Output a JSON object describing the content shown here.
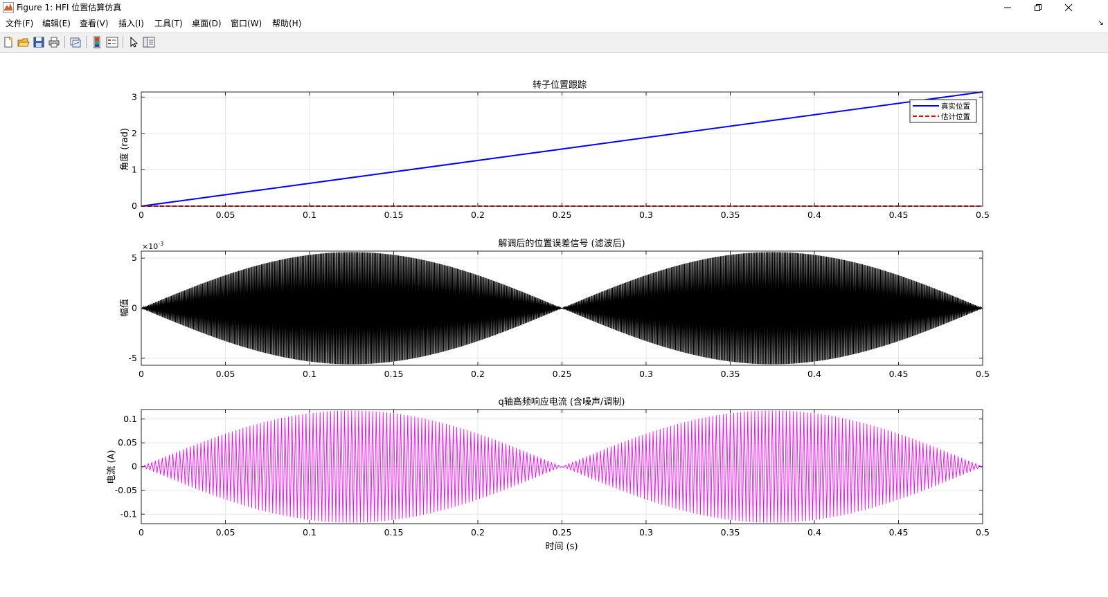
{
  "window": {
    "title": "Figure 1: HFI 位置估算仿真",
    "minimize_icon": "minimize-icon",
    "restore_icon": "restore-icon",
    "close_icon": "close-icon"
  },
  "menubar": {
    "items": [
      "文件(F)",
      "编辑(E)",
      "查看(V)",
      "插入(I)",
      "工具(T)",
      "桌面(D)",
      "窗口(W)",
      "帮助(H)"
    ],
    "dock_arrow": "↘"
  },
  "toolbar": {
    "icons": [
      "new-figure-icon",
      "open-file-icon",
      "save-icon",
      "print-icon",
      "link-plot-icon",
      "colorbar-icon",
      "legend-icon",
      "pointer-icon",
      "property-inspector-icon"
    ]
  },
  "colors": {
    "true_position": "#0000ff",
    "estimated_position": "#ff0000",
    "error_signal": "#000000",
    "q_current": "#ff00ff",
    "grid": "#e6e6e6"
  },
  "chart_data": [
    {
      "type": "line",
      "title": "转子位置跟踪",
      "xlabel": "",
      "ylabel": "角度 (rad)",
      "xlim": [
        0,
        0.5
      ],
      "ylim": [
        0,
        3.14
      ],
      "xticks": [
        "0",
        "0.05",
        "0.1",
        "0.15",
        "0.2",
        "0.25",
        "0.3",
        "0.35",
        "0.4",
        "0.45",
        "0.5"
      ],
      "yticks": [
        "0",
        "1",
        "2",
        "3"
      ],
      "grid": true,
      "legend": "top-right",
      "series": [
        {
          "name": "真实位置",
          "style": "solid",
          "x": [
            0,
            0.5
          ],
          "y": [
            0,
            3.1416
          ]
        },
        {
          "name": "估计位置",
          "style": "dashed",
          "x": [
            0,
            0.5
          ],
          "y": [
            0,
            0
          ]
        }
      ]
    },
    {
      "type": "line",
      "title": "解调后的位置误差信号 (滤波后)",
      "xlabel": "",
      "ylabel": "幅值",
      "exponent_label": "×10",
      "exponent_power": "-3",
      "xlim": [
        0,
        0.5
      ],
      "ylim": [
        -5.7,
        5.7
      ],
      "xticks": [
        "0",
        "0.05",
        "0.1",
        "0.15",
        "0.2",
        "0.25",
        "0.3",
        "0.35",
        "0.4",
        "0.45",
        "0.5"
      ],
      "yticks": [
        "-5",
        "0",
        "5"
      ],
      "grid": true,
      "envelope": {
        "peak": 5.6,
        "scale": 0.001,
        "zeros": [
          0,
          0.25,
          0.5
        ],
        "peaks": [
          0.125,
          0.375
        ]
      },
      "series": [
        {
          "name": "",
          "style": "dense-oscillation"
        }
      ]
    },
    {
      "type": "line",
      "title": "q轴高频响应电流 (含噪声/调制)",
      "xlabel": "时间 (s)",
      "ylabel": "电流 (A)",
      "xlim": [
        0,
        0.5
      ],
      "ylim": [
        -0.12,
        0.12
      ],
      "xticks": [
        "0",
        "0.05",
        "0.1",
        "0.15",
        "0.2",
        "0.25",
        "0.3",
        "0.35",
        "0.4",
        "0.45",
        "0.5"
      ],
      "yticks": [
        "-0.1",
        "-0.05",
        "0",
        "0.05",
        "0.1"
      ],
      "grid": true,
      "envelope": {
        "peak": 0.118,
        "zeros": [
          0,
          0.25,
          0.5
        ],
        "peaks": [
          0.125,
          0.375
        ]
      },
      "series": [
        {
          "name": "",
          "style": "dense-oscillation"
        }
      ]
    }
  ]
}
